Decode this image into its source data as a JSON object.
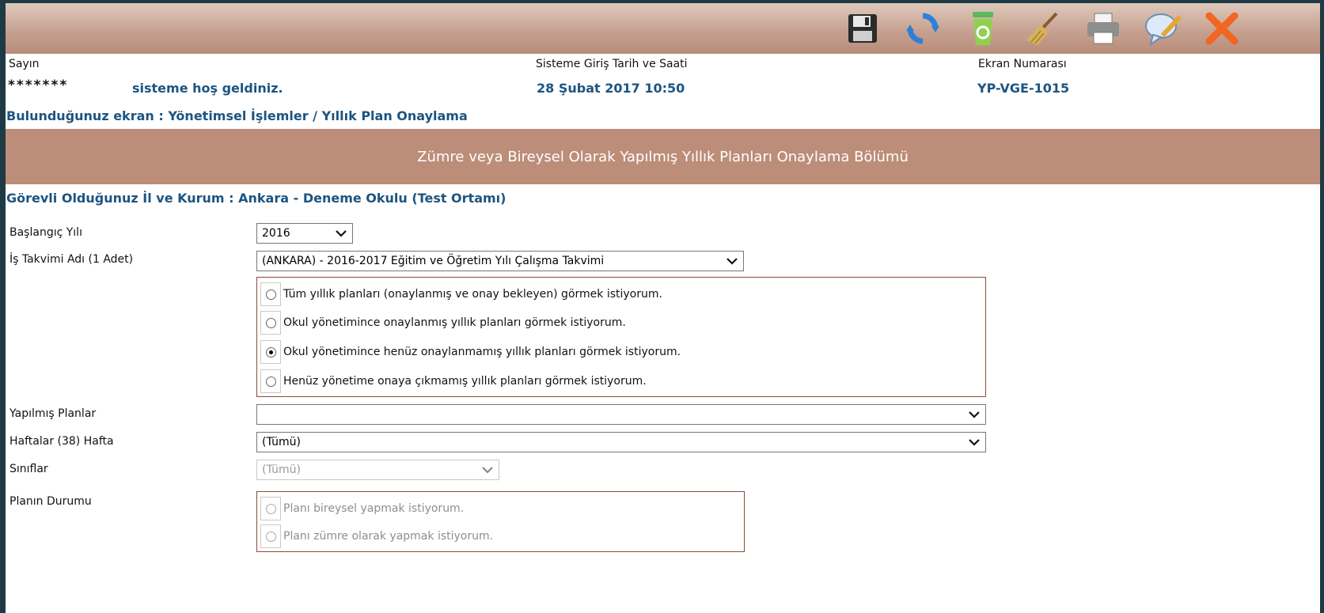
{
  "toolbar": {
    "icons": [
      "save-icon",
      "refresh-icon",
      "recycle-bin-icon",
      "broom-icon",
      "printer-icon",
      "comment-edit-icon",
      "close-icon"
    ]
  },
  "header": {
    "greeting_label": "Sayın",
    "user_name": "*******",
    "welcome_text": "sisteme hoş geldiniz.",
    "login_label": "Sisteme Giriş Tarih ve Saati",
    "login_value": "28 Şubat 2017 10:50",
    "screen_no_label": "Ekran Numarası",
    "screen_no_value": "YP-VGE-1015"
  },
  "breadcrumb": "Bulunduğunuz ekran : Yönetimsel İşlemler / Yıllık Plan Onaylama",
  "section_title": "Zümre veya Bireysel Olarak Yapılmış Yıllık Planları Onaylama Bölümü",
  "institution": "Görevli Olduğunuz İl ve Kurum : Ankara - Deneme Okulu (Test Ortamı)",
  "form": {
    "start_year": {
      "label": "Başlangıç Yılı",
      "value": "2016"
    },
    "work_calendar": {
      "label": "İş Takvimi Adı (1 Adet)",
      "value": "(ANKARA) - 2016-2017 Eğitim ve Öğretim Yılı Çalışma Takvimi"
    },
    "plan_filter": {
      "options": [
        "Tüm yıllık planları (onaylanmış ve onay bekleyen) görmek istiyorum.",
        "Okul yönetimince onaylanmış yıllık planları görmek istiyorum.",
        "Okul yönetimince henüz onaylanmamış yıllık planları görmek istiyorum.",
        "Henüz yönetime onaya çıkmamış yıllık planları görmek istiyorum."
      ],
      "selected_index": 2
    },
    "plans": {
      "label": "Yapılmış Planlar",
      "value": ""
    },
    "weeks": {
      "label": "Haftalar (38) Hafta",
      "value": "(Tümü)"
    },
    "classes": {
      "label": "Sınıflar",
      "value": "(Tümü)"
    },
    "plan_status": {
      "label": "Planın Durumu",
      "options": [
        "Planı bireysel yapmak istiyorum.",
        "Planı zümre olarak yapmak istiyorum."
      ]
    }
  },
  "colors": {
    "section_header": "#bc8d79",
    "accent_text": "#1d5480",
    "box_border": "#8b4b3c",
    "outer_background": "#1e3a44"
  }
}
